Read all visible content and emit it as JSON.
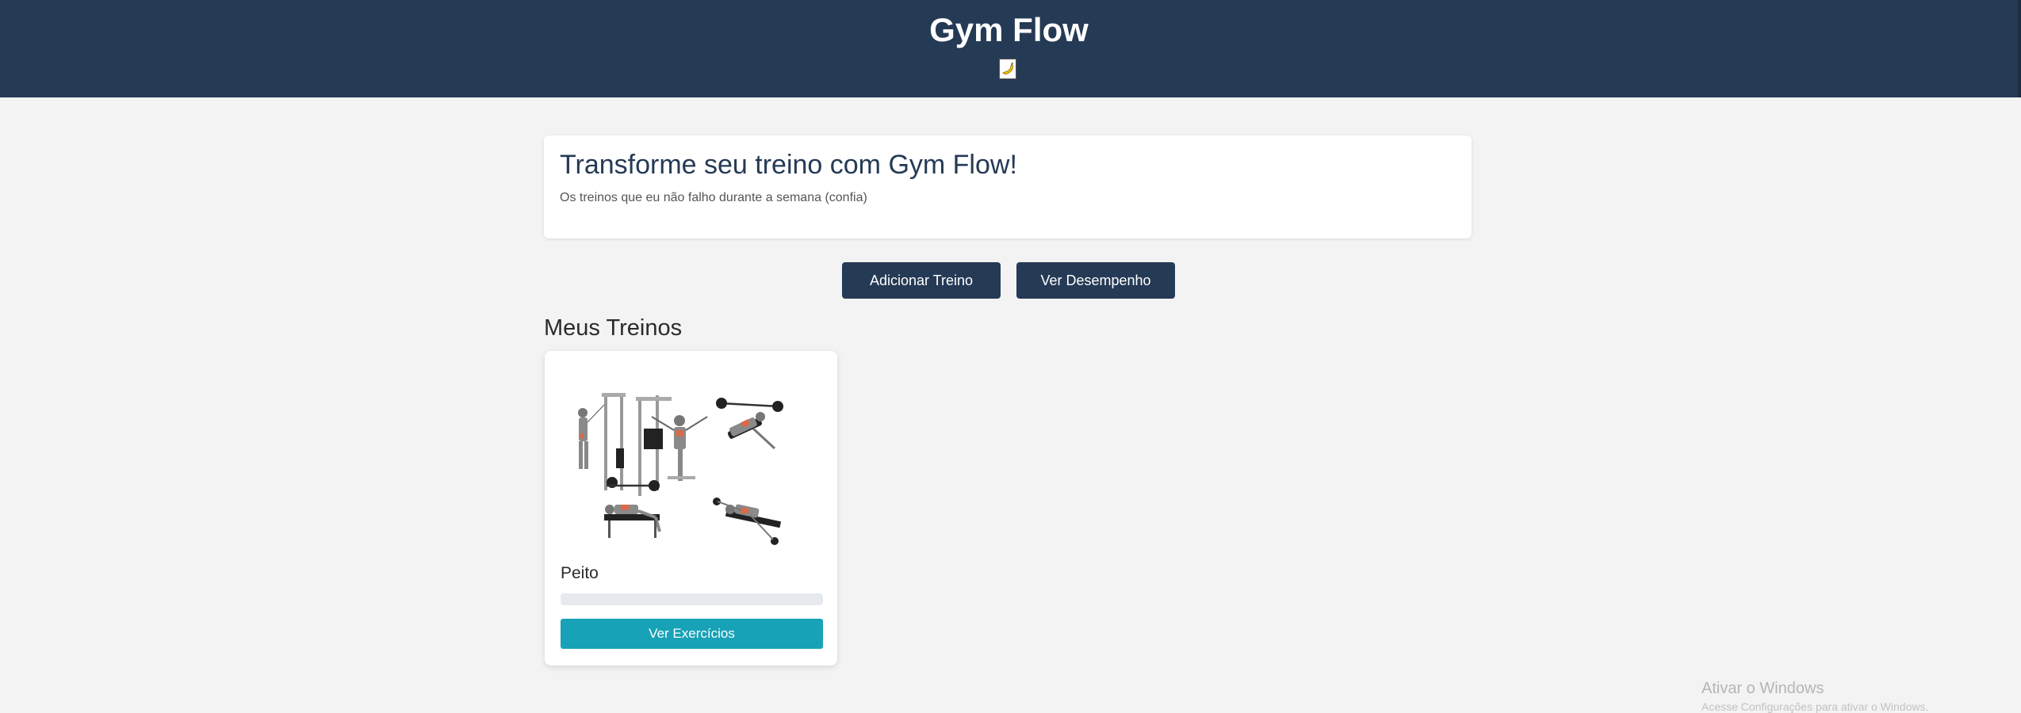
{
  "header": {
    "title": "Gym Flow",
    "logo_icon": "banana-icon"
  },
  "hero": {
    "title": "Transforme seu treino com Gym Flow!",
    "subtitle": "Os treinos que eu não falho durante a semana (confia)"
  },
  "actions": {
    "add_label": "Adicionar Treino",
    "performance_label": "Ver Desempenho"
  },
  "workouts": {
    "section_title": "Meus Treinos",
    "items": [
      {
        "title": "Peito",
        "image_icon": "chest-exercises-illustration",
        "progress_percent": 0,
        "button_label": "Ver Exercícios"
      }
    ]
  },
  "os_overlay": {
    "line1": "Ativar o Windows",
    "line2": "Acesse Configurações para ativar o Windows."
  },
  "colors": {
    "header_bg": "#253a55",
    "page_bg": "#f3f3f3",
    "accent": "#17a2b8"
  }
}
